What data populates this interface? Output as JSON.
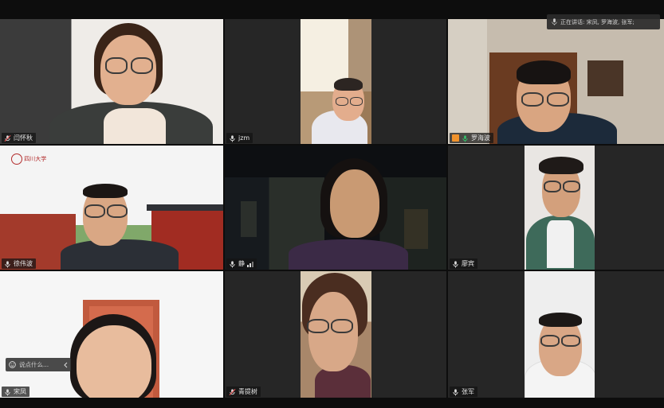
{
  "speaker_banner": {
    "text": "正在讲话: 宋凤, 罗海波, 张军;"
  },
  "chat": {
    "placeholder": "说点什么..."
  },
  "tiles": [
    {
      "name": "闫怀秋"
    },
    {
      "name": "jzm"
    },
    {
      "name": "罗海波"
    },
    {
      "name": "徐伟波"
    },
    {
      "name": "静"
    },
    {
      "name": "廖宾"
    },
    {
      "name": "宋凤"
    },
    {
      "name": "青提树"
    },
    {
      "name": "张军"
    }
  ],
  "background_logo": {
    "text": "四川大学"
  },
  "colors": {
    "active_speaker_outline": "#35c26b",
    "mic_active": "#35c26b",
    "share_badge": "#f0922b"
  },
  "icons": {
    "mic": "microphone-icon",
    "signal": "signal-bars-icon",
    "emoji": "emoji-icon",
    "collapse": "chevron-left-icon"
  }
}
